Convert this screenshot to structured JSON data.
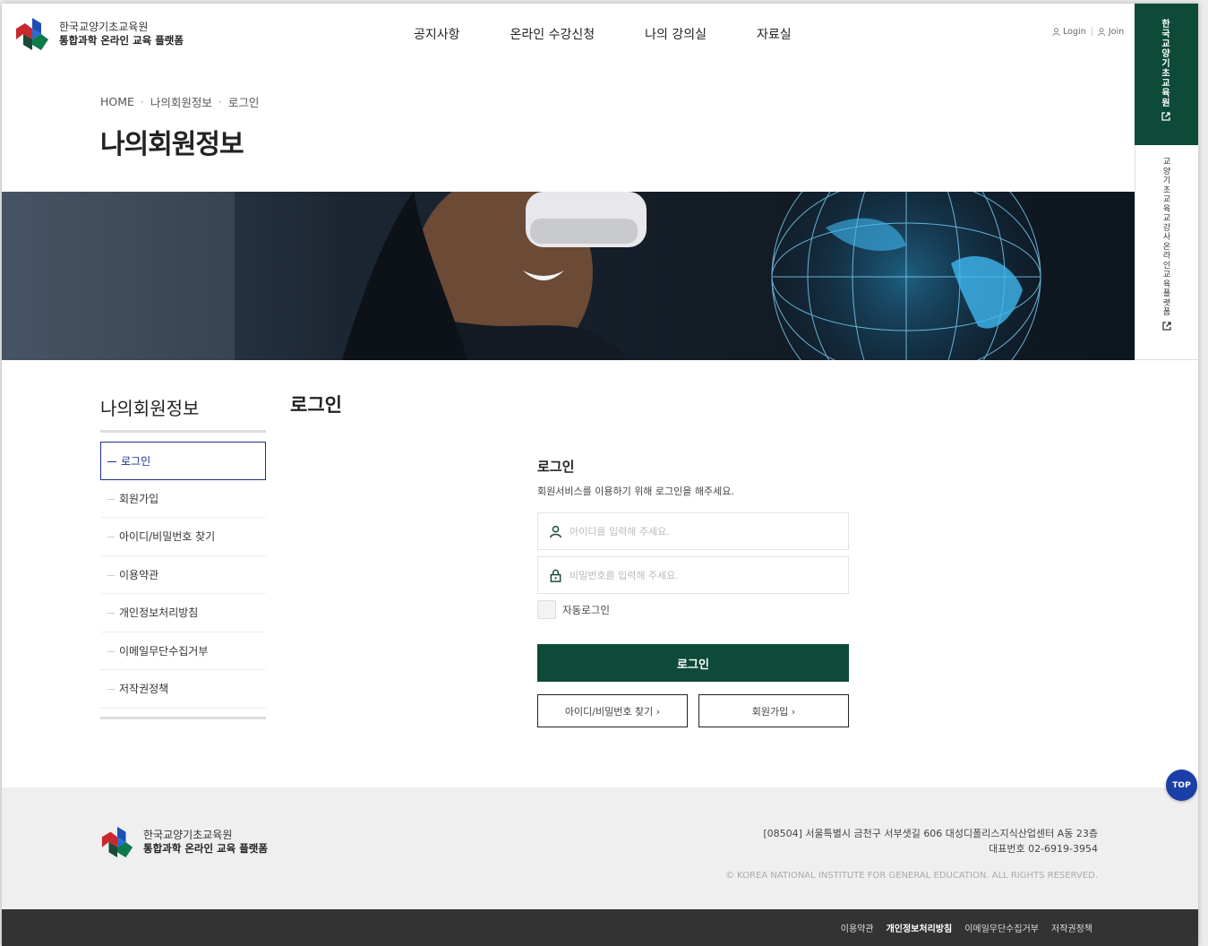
{
  "header": {
    "logo_line1": "한국교양기초교육원",
    "logo_line2": "통합과학 온라인 교육 플랫폼",
    "nav": [
      "공지사항",
      "온라인 수강신청",
      "나의 강의실",
      "자료실"
    ],
    "util_login": "Login",
    "util_join": "Join"
  },
  "side_tabs": {
    "tab1": "한국교양기초교육원",
    "tab2": "교양기초교육교강사온라인교육플랫폼"
  },
  "breadcrumb": [
    "HOME",
    "나의회원정보",
    "로그인"
  ],
  "page_title": "나의회원정보",
  "lnb": {
    "title": "나의회원정보",
    "items": [
      "로그인",
      "회원가입",
      "아이디/비밀번호 찾기",
      "이용약관",
      "개인정보처리방침",
      "이메일무단수집거부",
      "저작권정책"
    ]
  },
  "content_title": "로그인",
  "login": {
    "heading": "로그인",
    "description": "회원서비스를 이용하기 위해 로그인을 해주세요.",
    "id_placeholder": "아이디를 입력해 주세요.",
    "pw_placeholder": "비밀번호를 입력해 주세요.",
    "auto_login": "자동로그인",
    "submit": "로그인",
    "find_btn": "아이디/비밀번호 찾기 ›",
    "join_btn": "회원가입 ›"
  },
  "top_button": "TOP",
  "footer": {
    "logo_line1": "한국교양기초교육원",
    "logo_line2": "통합과학 온라인 교육 플랫폼",
    "address": "[08504] 서울특별시 금천구 서부샛길 606 대성디폴리스지식산업센터 A동 23층",
    "phone": "대표번호 02-6919-3954",
    "copyright": "© KOREA NATIONAL INSTITUTE FOR GENERAL EDUCATION. ALL RIGHTS RESERVED.",
    "links": [
      "이용약관",
      "개인정보처리방침",
      "이메일무단수집거부",
      "저작권정책"
    ]
  },
  "colors": {
    "brand_green": "#0d4a38",
    "active_blue": "#1a2f8f",
    "top_blue": "#1a3fa6"
  }
}
